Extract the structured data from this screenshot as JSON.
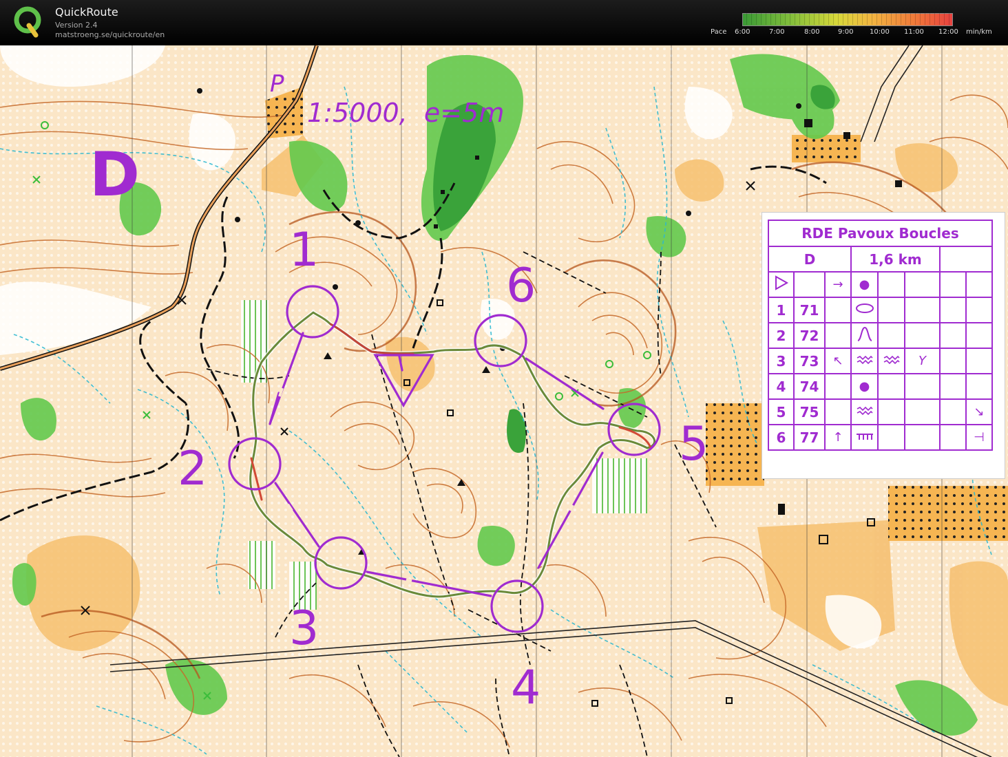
{
  "header": {
    "app_title": "QuickRoute",
    "version": "Version 2.4",
    "url": "matstroeng.se/quickroute/en",
    "logo_icon": "quickroute-q-logo-icon",
    "pace_label": "Pace",
    "pace_ticks": [
      "6:00",
      "7:00",
      "8:00",
      "9:00",
      "10:00",
      "11:00",
      "12:00"
    ],
    "pace_unit": "min/km"
  },
  "map": {
    "course_letter": "D",
    "scale_text": "1:5000,  e=5m",
    "parking_text": "P",
    "course_color": "#a02bd0",
    "control_numbers": [
      "1",
      "2",
      "3",
      "4",
      "5",
      "6"
    ]
  },
  "description": {
    "title": "RDE Pavoux Boucles",
    "course": "D",
    "length": "1,6 km",
    "start_row": {
      "num": "",
      "code": "",
      "col_d": "→",
      "col_e": "●"
    },
    "rows": [
      {
        "num": "1",
        "code": "71",
        "col_c": "",
        "col_d": "⬭",
        "col_e": "",
        "col_f": "",
        "col_g": "",
        "col_h": ""
      },
      {
        "num": "2",
        "code": "72",
        "col_c": "",
        "col_d": "∩",
        "col_e": "",
        "col_f": "",
        "col_g": "",
        "col_h": ""
      },
      {
        "num": "3",
        "code": "73",
        "col_c": "↖",
        "col_d": "⌇",
        "col_e": "⌇",
        "col_f": "Y",
        "col_g": "",
        "col_h": ""
      },
      {
        "num": "4",
        "code": "74",
        "col_c": "",
        "col_d": "●",
        "col_e": "",
        "col_f": "",
        "col_g": "",
        "col_h": ""
      },
      {
        "num": "5",
        "code": "75",
        "col_c": "",
        "col_d": "⌇",
        "col_e": "",
        "col_f": "",
        "col_g": "",
        "col_h": "↘"
      },
      {
        "num": "6",
        "code": "77",
        "col_c": "↑",
        "col_d": "╥",
        "col_e": "",
        "col_f": "",
        "col_g": "",
        "col_h": "⊣"
      }
    ]
  },
  "colors": {
    "course_purple": "#a02bd0",
    "contour_brown": "#c66a2a",
    "forest_green": "#4cc23a",
    "open_orange": "#f8c78a",
    "water_cyan": "#2bb8d0",
    "route_line": "#6a8a3a"
  }
}
